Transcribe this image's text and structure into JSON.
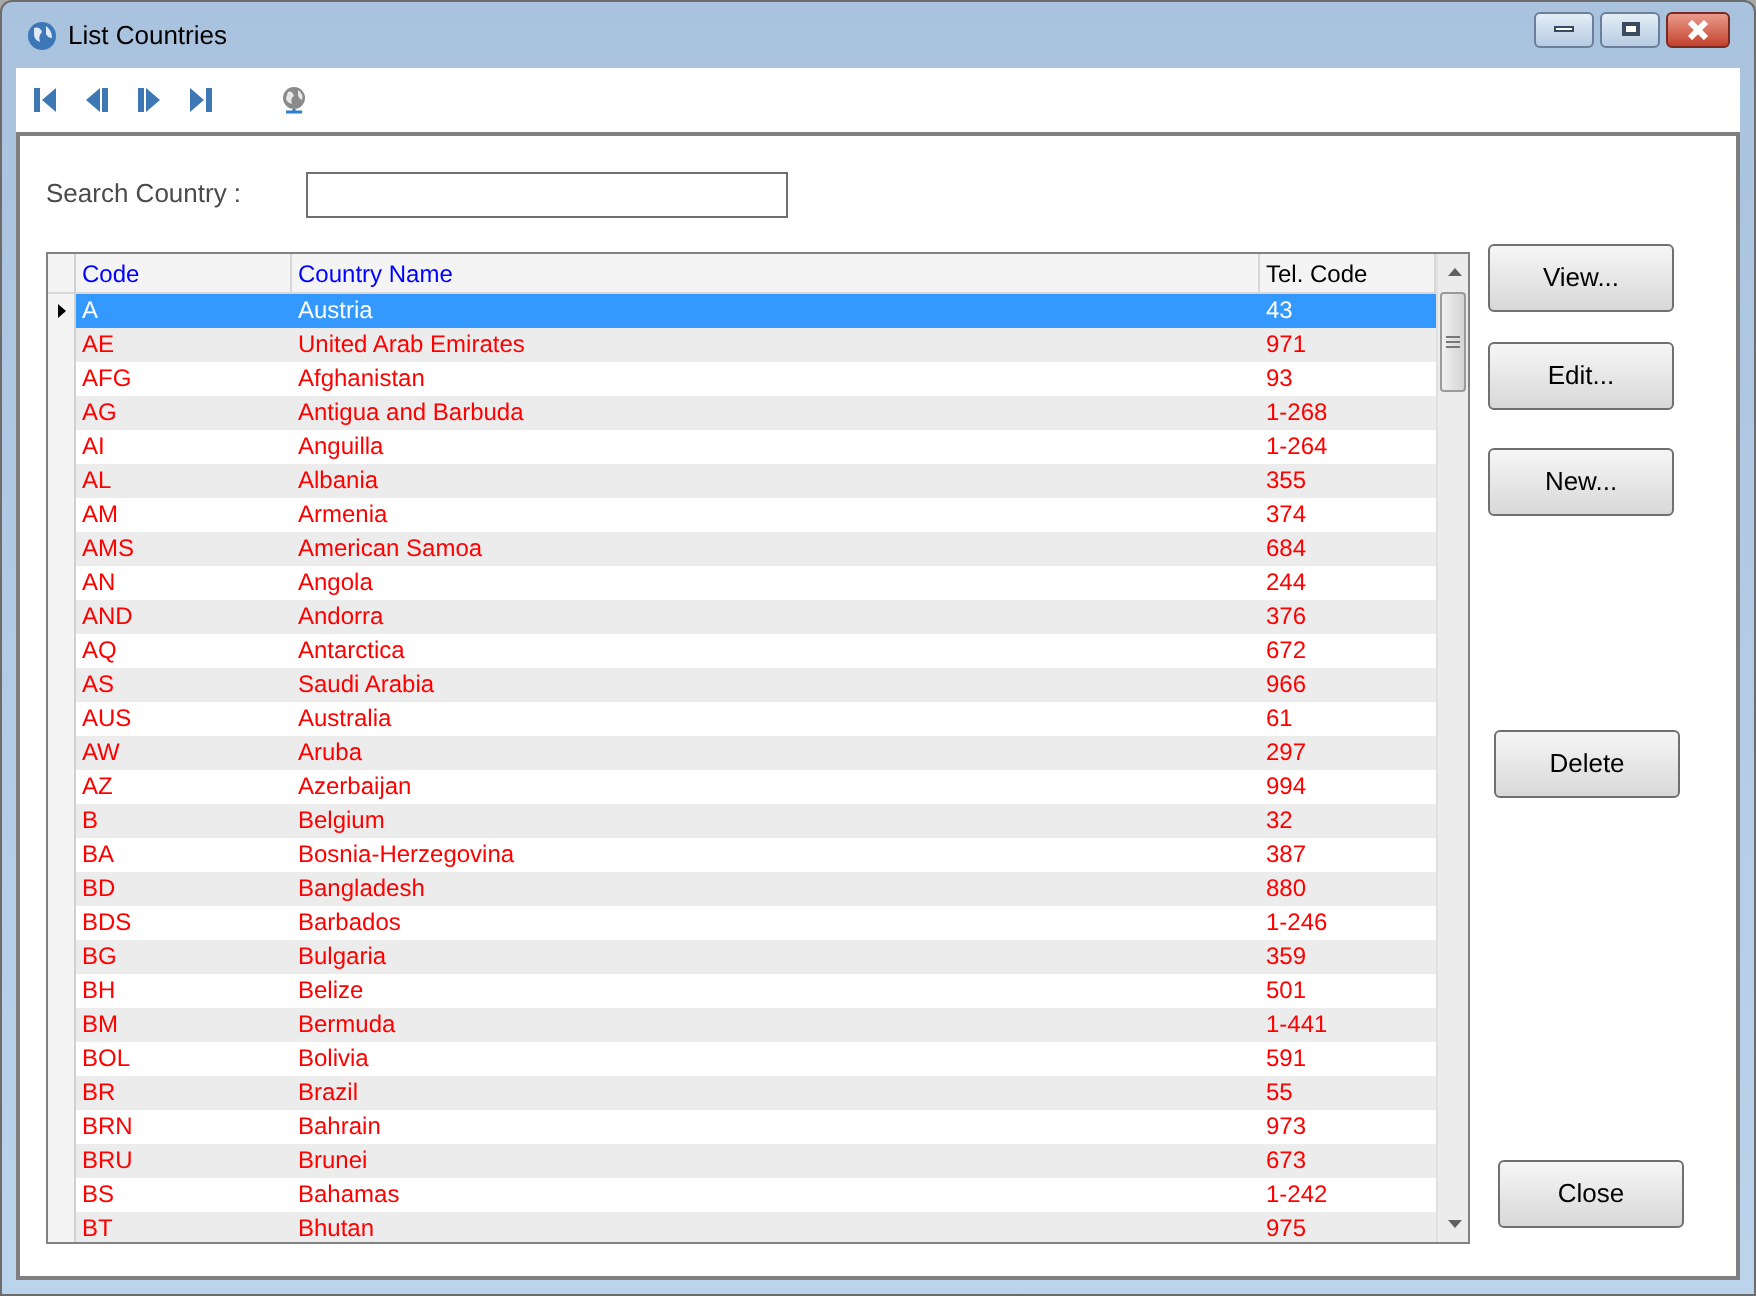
{
  "window": {
    "title": "List Countries"
  },
  "toolbar": [
    {
      "kind": "first"
    },
    {
      "kind": "prev"
    },
    {
      "kind": "next"
    },
    {
      "kind": "last"
    },
    {
      "kind": "globe"
    }
  ],
  "search": {
    "label": "Search Country :"
  },
  "table": {
    "columns": [
      "Code",
      "Country Name",
      "Tel. Code"
    ],
    "rows": [
      {
        "code": "A",
        "name": "Austria",
        "tel": "43",
        "selected": true
      },
      {
        "code": "AE",
        "name": "United Arab Emirates",
        "tel": "971",
        "selected": false
      },
      {
        "code": "AFG",
        "name": "Afghanistan",
        "tel": "93",
        "selected": false
      },
      {
        "code": "AG",
        "name": "Antigua and Barbuda",
        "tel": "1-268",
        "selected": false
      },
      {
        "code": "AI",
        "name": "Anguilla",
        "tel": "1-264",
        "selected": false
      },
      {
        "code": "AL",
        "name": "Albania",
        "tel": "355",
        "selected": false
      },
      {
        "code": "AM",
        "name": "Armenia",
        "tel": "374",
        "selected": false
      },
      {
        "code": "AMS",
        "name": "American Samoa",
        "tel": "684",
        "selected": false
      },
      {
        "code": "AN",
        "name": "Angola",
        "tel": "244",
        "selected": false
      },
      {
        "code": "AND",
        "name": "Andorra",
        "tel": "376",
        "selected": false
      },
      {
        "code": "AQ",
        "name": "Antarctica",
        "tel": "672",
        "selected": false
      },
      {
        "code": "AS",
        "name": "Saudi Arabia",
        "tel": "966",
        "selected": false
      },
      {
        "code": "AUS",
        "name": "Australia",
        "tel": "61",
        "selected": false
      },
      {
        "code": "AW",
        "name": "Aruba",
        "tel": "297",
        "selected": false
      },
      {
        "code": "AZ",
        "name": "Azerbaijan",
        "tel": "994",
        "selected": false
      },
      {
        "code": "B",
        "name": "Belgium",
        "tel": "32",
        "selected": false
      },
      {
        "code": "BA",
        "name": "Bosnia-Herzegovina",
        "tel": "387",
        "selected": false
      },
      {
        "code": "BD",
        "name": "Bangladesh",
        "tel": "880",
        "selected": false
      },
      {
        "code": "BDS",
        "name": "Barbados",
        "tel": "1-246",
        "selected": false
      },
      {
        "code": "BG",
        "name": "Bulgaria",
        "tel": "359",
        "selected": false
      },
      {
        "code": "BH",
        "name": "Belize",
        "tel": "501",
        "selected": false
      },
      {
        "code": "BM",
        "name": "Bermuda",
        "tel": "1-441",
        "selected": false
      },
      {
        "code": "BOL",
        "name": "Bolivia",
        "tel": "591",
        "selected": false
      },
      {
        "code": "BR",
        "name": "Brazil",
        "tel": "55",
        "selected": false
      },
      {
        "code": "BRN",
        "name": "Bahrain",
        "tel": "973",
        "selected": false
      },
      {
        "code": "BRU",
        "name": "Brunei",
        "tel": "673",
        "selected": false
      },
      {
        "code": "BS",
        "name": "Bahamas",
        "tel": "1-242",
        "selected": false
      },
      {
        "code": "BT",
        "name": "Bhutan",
        "tel": "975",
        "selected": false
      }
    ]
  },
  "buttons": [
    "View...",
    "Edit...",
    "New...",
    "Delete",
    "Close"
  ]
}
